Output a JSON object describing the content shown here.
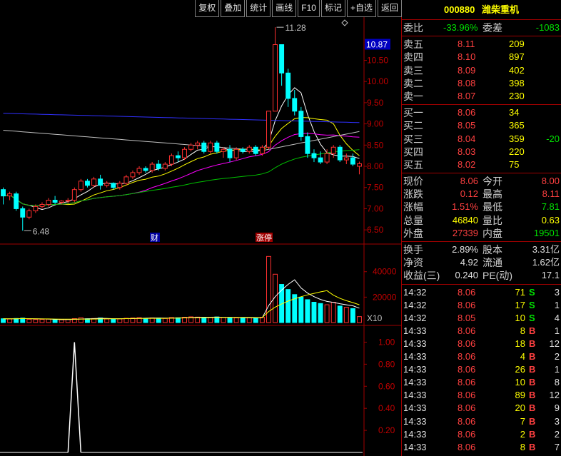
{
  "toolbar": [
    "复权",
    "叠加",
    "统计",
    "画线",
    "F10",
    "标记",
    "+自选",
    "返回"
  ],
  "stock": {
    "code": "000880",
    "name": "潍柴重机"
  },
  "ratio": {
    "wei_bi_label": "委比",
    "wei_bi": "-33.96%",
    "wei_cha_label": "委差",
    "wei_cha": "-1083"
  },
  "sell_levels": [
    {
      "label": "卖五",
      "price": "8.11",
      "vol": "209"
    },
    {
      "label": "卖四",
      "price": "8.10",
      "vol": "897"
    },
    {
      "label": "卖三",
      "price": "8.09",
      "vol": "402"
    },
    {
      "label": "卖二",
      "price": "8.08",
      "vol": "398"
    },
    {
      "label": "卖一",
      "price": "8.07",
      "vol": "230"
    }
  ],
  "buy_levels": [
    {
      "label": "买一",
      "price": "8.06",
      "vol": "34",
      "chg": ""
    },
    {
      "label": "买二",
      "price": "8.05",
      "vol": "365",
      "chg": ""
    },
    {
      "label": "买三",
      "price": "8.04",
      "vol": "359",
      "chg": "-20"
    },
    {
      "label": "买四",
      "price": "8.03",
      "vol": "220",
      "chg": ""
    },
    {
      "label": "买五",
      "price": "8.02",
      "vol": "75",
      "chg": ""
    }
  ],
  "stats": [
    {
      "l1": "现价",
      "v1": "8.06",
      "c1": "red",
      "l2": "今开",
      "v2": "8.00",
      "c2": "red"
    },
    {
      "l1": "涨跌",
      "v1": "0.12",
      "c1": "red",
      "l2": "最高",
      "v2": "8.11",
      "c2": "red"
    },
    {
      "l1": "涨幅",
      "v1": "1.51%",
      "c1": "red",
      "l2": "最低",
      "v2": "7.81",
      "c2": "green"
    },
    {
      "l1": "总量",
      "v1": "46840",
      "c1": "yellow",
      "l2": "量比",
      "v2": "0.63",
      "c2": "yellow"
    },
    {
      "l1": "外盘",
      "v1": "27339",
      "c1": "red",
      "l2": "内盘",
      "v2": "19501",
      "c2": "green"
    }
  ],
  "fundamentals": [
    {
      "l1": "换手",
      "v1": "2.89%",
      "l2": "股本",
      "v2": "3.31亿"
    },
    {
      "l1": "净资",
      "v1": "4.92",
      "l2": "流通",
      "v2": "1.62亿"
    },
    {
      "l1": "收益(三)",
      "v1": "0.240",
      "l2": "PE(动)",
      "v2": "17.1"
    }
  ],
  "ticks": [
    {
      "time": "14:32",
      "price": "8.06",
      "vol": "71",
      "side": "S",
      "n": "3"
    },
    {
      "time": "14:32",
      "price": "8.06",
      "vol": "17",
      "side": "S",
      "n": "1"
    },
    {
      "time": "14:32",
      "price": "8.05",
      "vol": "10",
      "side": "S",
      "n": "4"
    },
    {
      "time": "14:33",
      "price": "8.06",
      "vol": "8",
      "side": "B",
      "n": "1"
    },
    {
      "time": "14:33",
      "price": "8.06",
      "vol": "18",
      "side": "B",
      "n": "12"
    },
    {
      "time": "14:33",
      "price": "8.06",
      "vol": "4",
      "side": "B",
      "n": "2"
    },
    {
      "time": "14:33",
      "price": "8.06",
      "vol": "26",
      "side": "B",
      "n": "1"
    },
    {
      "time": "14:33",
      "price": "8.06",
      "vol": "10",
      "side": "B",
      "n": "8"
    },
    {
      "time": "14:33",
      "price": "8.06",
      "vol": "89",
      "side": "B",
      "n": "12"
    },
    {
      "time": "14:33",
      "price": "8.06",
      "vol": "20",
      "side": "B",
      "n": "9"
    },
    {
      "time": "14:33",
      "price": "8.06",
      "vol": "7",
      "side": "B",
      "n": "3"
    },
    {
      "time": "14:33",
      "price": "8.06",
      "vol": "2",
      "side": "B",
      "n": "2"
    },
    {
      "time": "14:33",
      "price": "8.06",
      "vol": "8",
      "side": "B",
      "n": "7"
    }
  ],
  "chart": {
    "price_axis": [
      "10.50",
      "10.00",
      "9.50",
      "9.00",
      "8.50",
      "8.00",
      "7.50",
      "7.00",
      "6.50"
    ],
    "current_price_label": "10.87",
    "high_label": "11.28",
    "low_label": "6.48",
    "markers": [
      "财",
      "涨停"
    ],
    "volume_axis": [
      "40000",
      "20000"
    ],
    "volume_unit": "X10",
    "indicator_axis": [
      "1.00",
      "0.80",
      "0.60",
      "0.40",
      "0.20"
    ]
  },
  "chart_data": {
    "type": "candlestick",
    "ylim": [
      6.3,
      11.35
    ],
    "candles": [
      [
        7.45,
        7.5,
        7.1,
        7.3
      ],
      [
        7.3,
        7.4,
        7.2,
        7.35
      ],
      [
        7.35,
        7.4,
        6.95,
        7.0
      ],
      [
        7.0,
        7.05,
        6.48,
        6.8
      ],
      [
        6.8,
        7.0,
        6.75,
        6.95
      ],
      [
        6.95,
        7.1,
        6.9,
        7.05
      ],
      [
        7.05,
        7.15,
        7.0,
        7.1
      ],
      [
        7.1,
        7.25,
        7.05,
        7.2
      ],
      [
        7.2,
        7.3,
        7.1,
        7.15
      ],
      [
        7.15,
        7.2,
        7.1,
        7.18
      ],
      [
        7.18,
        7.25,
        7.12,
        7.2
      ],
      [
        7.2,
        7.5,
        7.15,
        7.45
      ],
      [
        7.45,
        7.7,
        7.4,
        7.65
      ],
      [
        7.65,
        7.7,
        7.5,
        7.55
      ],
      [
        7.55,
        7.75,
        7.5,
        7.7
      ],
      [
        7.7,
        7.8,
        7.45,
        7.55
      ],
      [
        7.55,
        7.65,
        7.5,
        7.6
      ],
      [
        7.6,
        7.62,
        7.45,
        7.5
      ],
      [
        7.5,
        7.65,
        7.45,
        7.6
      ],
      [
        7.6,
        7.8,
        7.55,
        7.75
      ],
      [
        7.75,
        7.9,
        7.7,
        7.85
      ],
      [
        7.85,
        8.0,
        7.8,
        7.95
      ],
      [
        7.95,
        8.0,
        7.85,
        7.9
      ],
      [
        7.9,
        8.1,
        7.85,
        8.05
      ],
      [
        8.05,
        8.15,
        7.9,
        7.95
      ],
      [
        7.95,
        8.1,
        7.9,
        8.05
      ],
      [
        8.05,
        8.3,
        8.0,
        8.25
      ],
      [
        8.25,
        8.35,
        8.1,
        8.2
      ],
      [
        8.2,
        8.45,
        8.15,
        8.4
      ],
      [
        8.4,
        8.55,
        8.35,
        8.5
      ],
      [
        8.5,
        8.6,
        8.4,
        8.55
      ],
      [
        8.55,
        8.6,
        8.3,
        8.35
      ],
      [
        8.35,
        8.6,
        8.3,
        8.55
      ],
      [
        8.55,
        8.6,
        8.3,
        8.35
      ],
      [
        8.35,
        8.45,
        8.2,
        8.4
      ],
      [
        8.4,
        8.5,
        8.1,
        8.2
      ],
      [
        8.2,
        8.45,
        8.15,
        8.4
      ],
      [
        8.4,
        8.45,
        8.3,
        8.35
      ],
      [
        8.35,
        8.5,
        8.3,
        8.45
      ],
      [
        8.45,
        8.5,
        8.25,
        8.3
      ],
      [
        8.3,
        8.5,
        8.25,
        8.45
      ],
      [
        8.45,
        9.3,
        8.4,
        9.3
      ],
      [
        9.3,
        11.28,
        9.3,
        10.87
      ],
      [
        10.87,
        10.87,
        9.9,
        10.2
      ],
      [
        10.2,
        10.3,
        9.4,
        9.6
      ],
      [
        9.6,
        9.8,
        9.2,
        9.3
      ],
      [
        9.3,
        9.4,
        8.6,
        8.7
      ],
      [
        8.7,
        8.8,
        8.2,
        8.3
      ],
      [
        8.3,
        8.4,
        8.1,
        8.2
      ],
      [
        8.2,
        8.35,
        8.05,
        8.1
      ],
      [
        8.1,
        8.4,
        8.05,
        8.3
      ],
      [
        8.3,
        8.5,
        8.2,
        8.45
      ],
      [
        8.45,
        8.5,
        8.1,
        8.15
      ],
      [
        8.15,
        8.3,
        8.05,
        8.2
      ],
      [
        8.2,
        8.3,
        8.0,
        8.05
      ],
      [
        8.0,
        8.11,
        7.81,
        8.06
      ]
    ],
    "volume_ylim": [
      0,
      55000
    ],
    "volumes": [
      3000,
      2800,
      3200,
      3500,
      2600,
      2400,
      2500,
      2700,
      2300,
      2200,
      2400,
      3100,
      3800,
      3000,
      3200,
      3600,
      2800,
      2600,
      2900,
      3400,
      3600,
      3900,
      3300,
      3700,
      3500,
      3200,
      4000,
      3800,
      4200,
      4500,
      4300,
      4100,
      3900,
      4400,
      4000,
      3800,
      3700,
      3600,
      3900,
      3500,
      4200,
      52000,
      38000,
      30000,
      26000,
      22000,
      20000,
      18000,
      16000,
      15000,
      14000,
      16000,
      13000,
      12000,
      11000,
      4684
    ],
    "indicator_ylim": [
      0,
      1.1
    ],
    "indicator": [
      0,
      0,
      0,
      0,
      0,
      0,
      0,
      0,
      0,
      0,
      0,
      0,
      0,
      0,
      0,
      0,
      0,
      0,
      0,
      0,
      0,
      0,
      0,
      0,
      0,
      0,
      0,
      0,
      0,
      0,
      0,
      0,
      0,
      0,
      0,
      0,
      0,
      0,
      0,
      0,
      0,
      0,
      0,
      0,
      0,
      0,
      0,
      0,
      0,
      0,
      0,
      0,
      0,
      0,
      0,
      0
    ],
    "indicator_spike": {
      "index": 11,
      "value": 1.0
    }
  }
}
